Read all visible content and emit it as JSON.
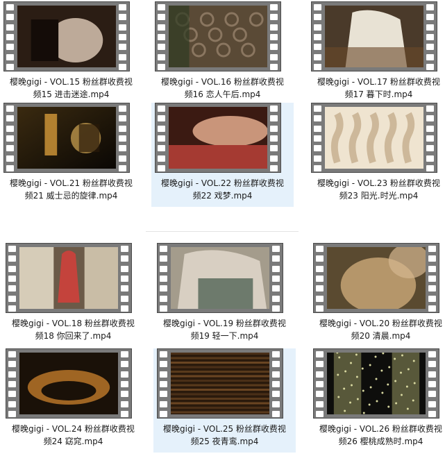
{
  "rows": [
    {
      "items": [
        {
          "name_line1": "樱晚gigi - VOL.15 粉丝群收费视",
          "name_line2": "频15 进击迷途.mp4",
          "selected": false,
          "thumb": {
            "bg": "#2b1d14",
            "accent": "#d7c3b0",
            "shape": "body"
          }
        },
        {
          "name_line1": "樱晚gigi - VOL.16 粉丝群收费视",
          "name_line2": "频16 恋人午后.mp4",
          "selected": false,
          "thumb": {
            "bg": "#5a4a36",
            "accent": "#8a7660",
            "shape": "lace"
          }
        },
        {
          "name_line1": "樱晚gigi - VOL.17 粉丝群收费视",
          "name_line2": "频17 暮下时.mp4",
          "selected": false,
          "thumb": {
            "bg": "#4a3a2a",
            "accent": "#e8e2d4",
            "shape": "shirt"
          }
        }
      ]
    },
    {
      "items": [
        {
          "name_line1": "樱晚gigi - VOL.21 粉丝群收费视",
          "name_line2": "频21 威士忌的旋律.mp4",
          "selected": false,
          "thumb": {
            "bg": "#1d1508",
            "accent": "#d59a3a",
            "shape": "bottle"
          }
        },
        {
          "name_line1": "樱晚gigi - VOL.22 粉丝群收费视",
          "name_line2": "频22 戏梦.mp4",
          "selected": true,
          "thumb": {
            "bg": "#3b1a12",
            "accent": "#a53a32",
            "shape": "couch"
          }
        },
        {
          "name_line1": "樱晚gigi - VOL.23 粉丝群收费视",
          "name_line2": "频23 阳光.时光.mp4",
          "selected": false,
          "thumb": {
            "bg": "#cdb89a",
            "accent": "#efe4d0",
            "shape": "railing"
          }
        }
      ]
    },
    {
      "items": [
        {
          "name_line1": "樱晚gigi - VOL.18 粉丝群收费视",
          "name_line2": "频18 你回来了.mp4",
          "selected": false,
          "thumb": {
            "bg": "#6b5a48",
            "accent": "#c4433c",
            "shape": "dress"
          }
        },
        {
          "name_line1": "樱晚gigi - VOL.19 粉丝群收费视",
          "name_line2": "频19 轻一下.mp4",
          "selected": false,
          "thumb": {
            "bg": "#a49c8c",
            "accent": "#6d7a6c",
            "shape": "top"
          }
        },
        {
          "name_line1": "樱晚gigi - VOL.20 粉丝群收费视",
          "name_line2": "频20 清晨.mp4",
          "selected": false,
          "thumb": {
            "bg": "#5a4a30",
            "accent": "#b5966a",
            "shape": "skin"
          }
        }
      ]
    },
    {
      "items": [
        {
          "name_line1": "樱晚gigi - VOL.24 粉丝群收费视",
          "name_line2": "频24 窈窕.mp4",
          "selected": false,
          "thumb": {
            "bg": "#1a1108",
            "accent": "#c07a2a",
            "shape": "glow"
          }
        },
        {
          "name_line1": "樱晚gigi - VOL.25 粉丝群收费视",
          "name_line2": "频25 夜青鸾.mp4",
          "selected": true,
          "thumb": {
            "bg": "#2a1a0c",
            "accent": "#7a5028",
            "shape": "blinds"
          }
        },
        {
          "name_line1": "樱晚gigi - VOL.26 粉丝群收费视",
          "name_line2": "频26 樱桃成熟时.mp4",
          "selected": false,
          "thumb": {
            "bg": "#0e0e0c",
            "accent": "#8a8a5a",
            "shape": "curtain"
          }
        }
      ]
    }
  ]
}
